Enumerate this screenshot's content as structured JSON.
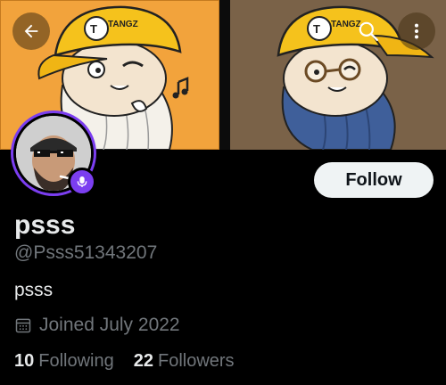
{
  "profile": {
    "display_name": "psss",
    "handle": "@Psss51343207",
    "bio": "psss",
    "joined": "Joined July 2022",
    "following_count": "10",
    "following_label": "Following",
    "followers_count": "22",
    "followers_label": "Followers"
  },
  "actions": {
    "follow_label": "Follow"
  },
  "banner": {
    "cap_text_left": "TANGZ",
    "cap_text_right": "TANGZ"
  },
  "icons": {
    "back": "back-arrow-icon",
    "search": "search-icon",
    "more": "more-vertical-icon",
    "calendar": "calendar-icon",
    "spaces": "microphone-icon"
  },
  "colors": {
    "background": "#000000",
    "text_primary": "#e7e9ea",
    "text_secondary": "#71767b",
    "follow_button_bg": "#eff3f4",
    "avatar_ring": "#7b3ef0",
    "banner_left_bg": "#f2a33c",
    "banner_right_bg": "#7a6248"
  }
}
